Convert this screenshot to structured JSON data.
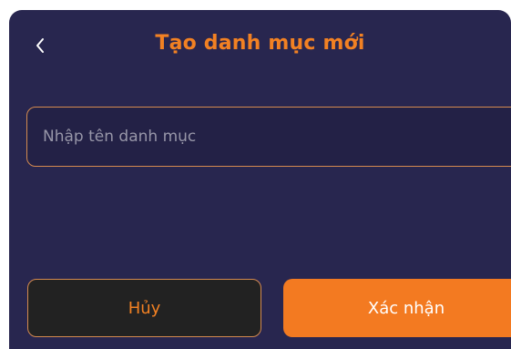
{
  "header": {
    "title": "Tạo danh mục mới",
    "back_icon": "chevron-left-icon"
  },
  "form": {
    "category_name_value": "",
    "category_name_placeholder": "Nhập tên danh mục"
  },
  "actions": {
    "cancel_label": "Hủy",
    "confirm_label": "Xác nhận"
  },
  "colors": {
    "background": "#28264f",
    "accent": "#f37a21",
    "accent_border": "#d48a4f",
    "cancel_bg": "#222222",
    "placeholder": "#9796a8"
  }
}
